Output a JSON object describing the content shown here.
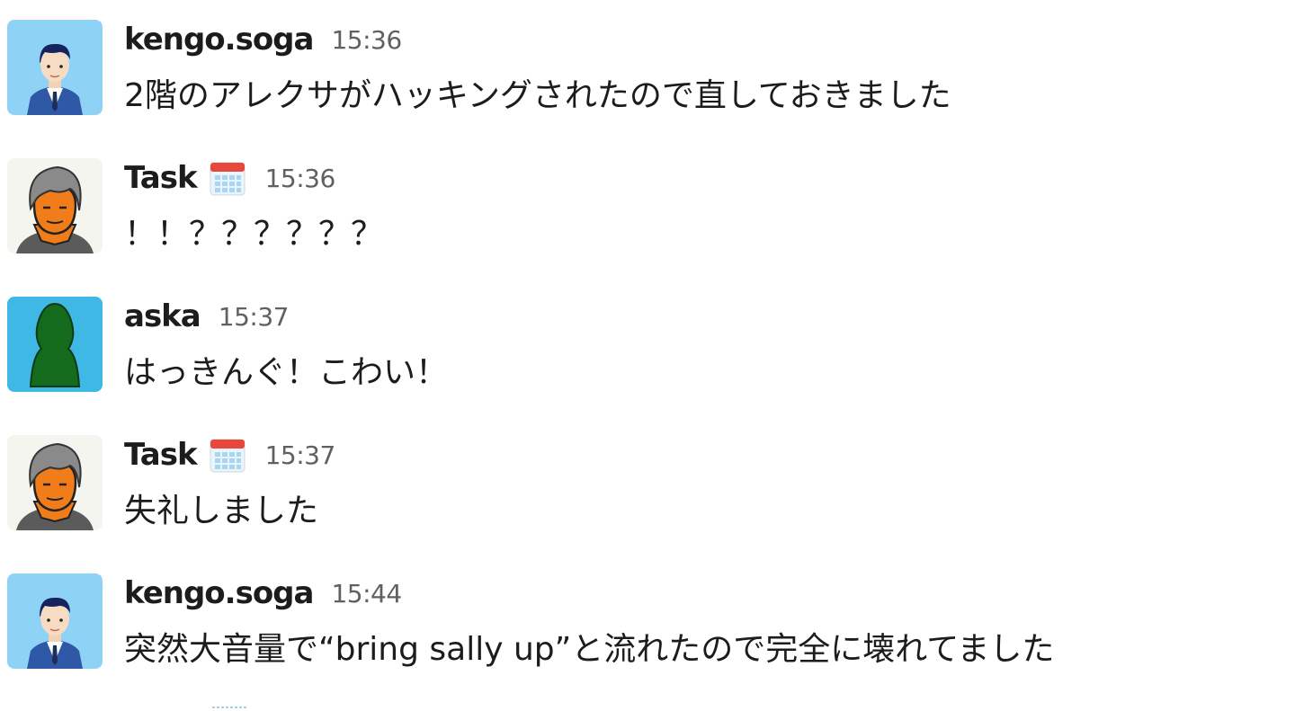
{
  "colors": {
    "username": "#1d1c1d",
    "timestamp": "#616061",
    "text": "#1d1c1d",
    "kengo_avatar_bg": "#8ed3f5",
    "task_avatar_bg": "#f5f5f0",
    "aska_avatar_bg": "#3fb8e6",
    "aska_silhouette": "#146b1e"
  },
  "messages": [
    {
      "user": "kengo.soga",
      "avatar_icon": "man-in-suit-avatar-icon",
      "time": "15:36",
      "text": "2階のアレクサがハッキングされたので直しておきました"
    },
    {
      "user": "Task",
      "avatar_icon": "orange-face-avatar-icon",
      "badge_icon": "calendar-icon",
      "time": "15:36",
      "text": "！！？？？？？？"
    },
    {
      "user": "aska",
      "avatar_icon": "green-silhouette-avatar-icon",
      "time": "15:37",
      "text": "はっきんぐ！こわい！"
    },
    {
      "user": "Task",
      "avatar_icon": "orange-face-avatar-icon",
      "badge_icon": "calendar-icon",
      "time": "15:37",
      "text": "失礼しました"
    },
    {
      "user": "kengo.soga",
      "avatar_icon": "man-in-suit-avatar-icon",
      "time": "15:44",
      "text": "突然大音量で“bring sally up”と流れたので完全に壊れてました"
    }
  ]
}
